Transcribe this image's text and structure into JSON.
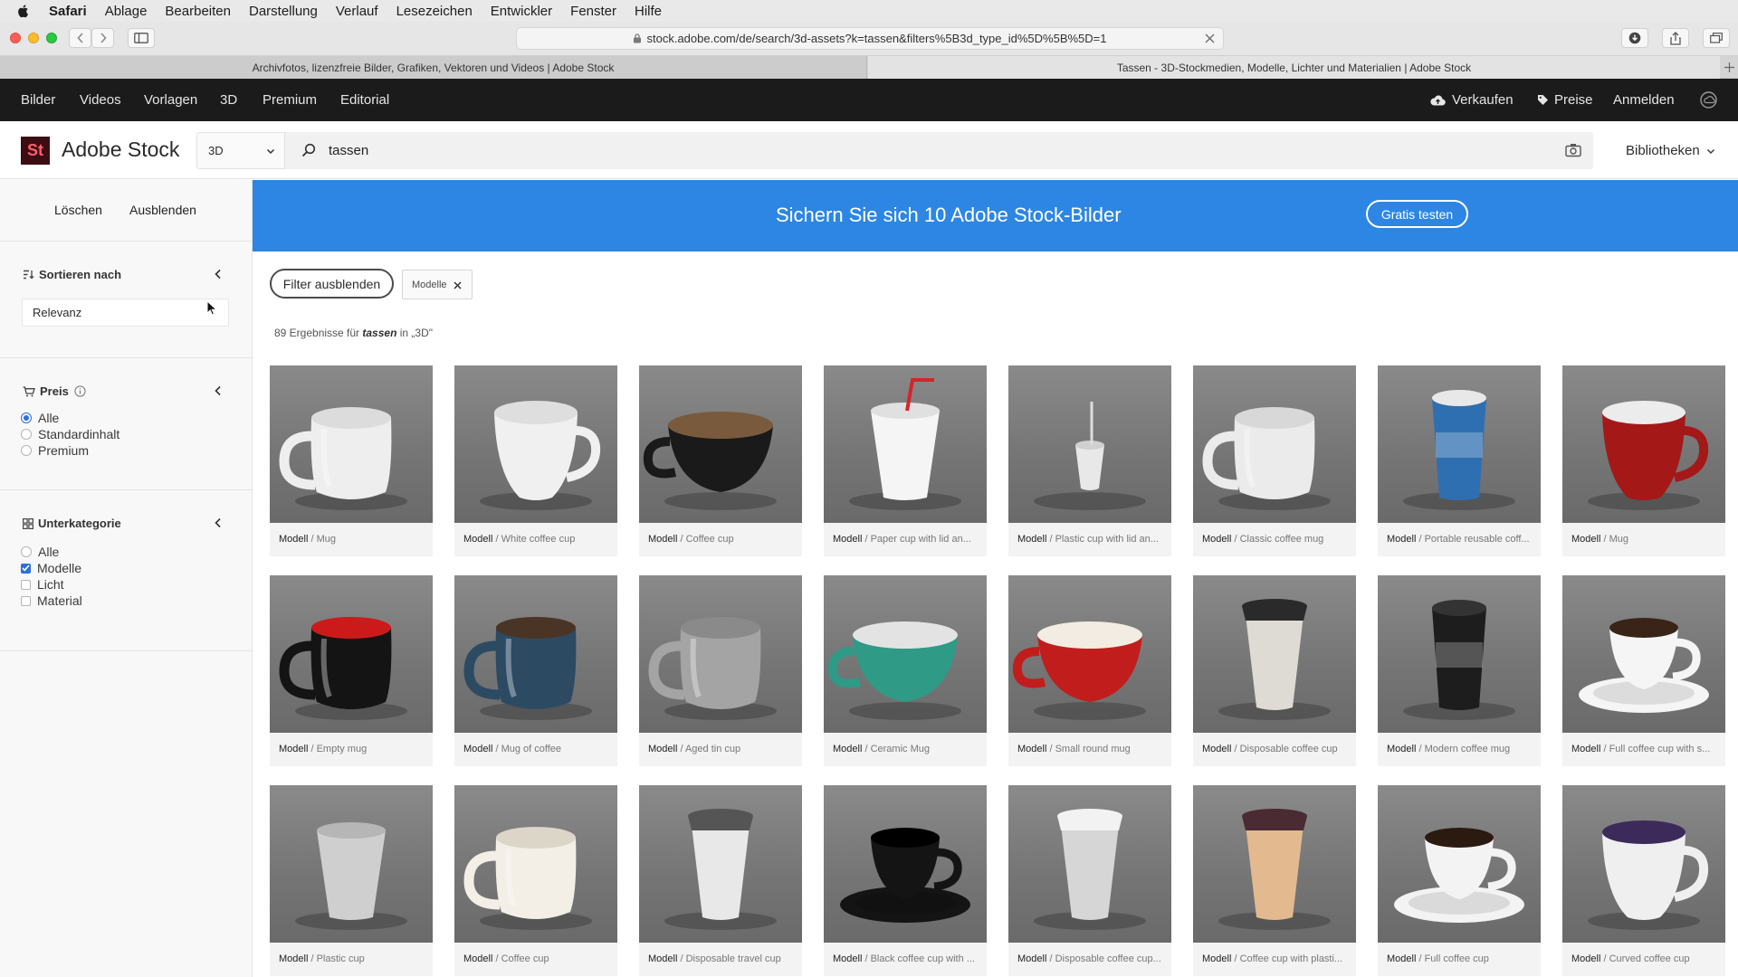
{
  "menubar": {
    "app": "Safari",
    "items": [
      "Ablage",
      "Bearbeiten",
      "Darstellung",
      "Verlauf",
      "Lesezeichen",
      "Entwickler",
      "Fenster",
      "Hilfe"
    ]
  },
  "browser": {
    "url": "stock.adobe.com/de/search/3d-assets?k=tassen&filters%5B3d_type_id%5D%5B%5D=1",
    "tabs": [
      {
        "title": "Archivfotos, lizenzfreie Bilder, Grafiken, Vektoren und Videos | Adobe Stock"
      },
      {
        "title": "Tassen - 3D-Stockmedien, Modelle, Lichter und Materialien | Adobe Stock"
      }
    ]
  },
  "topnav": {
    "items": [
      "Bilder",
      "Videos",
      "Vorlagen",
      "3D",
      "Premium",
      "Editorial"
    ],
    "sell": "Verkaufen",
    "pricing": "Preise",
    "signin": "Anmelden"
  },
  "header": {
    "logo_mark": "St",
    "logo_text": "Adobe Stock",
    "category": "3D",
    "search_value": "tassen",
    "libraries": "Bibliotheken"
  },
  "sidebar": {
    "clear": "Löschen",
    "hide": "Ausblenden",
    "sort": {
      "title": "Sortieren nach",
      "value": "Relevanz"
    },
    "price": {
      "title": "Preis",
      "options": [
        "Alle",
        "Standardinhalt",
        "Premium"
      ],
      "selected": 0
    },
    "subcategory": {
      "title": "Unterkategorie",
      "options": [
        "Alle",
        "Modelle",
        "Licht",
        "Material"
      ],
      "checked": 1
    }
  },
  "banner": {
    "text": "Sichern Sie sich 10 Adobe Stock-Bilder",
    "button": "Gratis testen"
  },
  "filters": {
    "toggle": "Filter ausblenden",
    "tag": "Modelle"
  },
  "results": {
    "prefix": "89 Ergebnisse für ",
    "query": "tassen",
    "suffix": " in „3D\""
  },
  "colors": {
    "banner": "#2d86e3",
    "nav": "#1b1b1b",
    "accent": "#2d6fde",
    "logo": "#3d0d13"
  },
  "assets": [
    {
      "kind": "Modell",
      "name": "Mug",
      "shape": "mug",
      "color": "#eeeeee",
      "inner": "#dcdcdc"
    },
    {
      "kind": "Modell",
      "name": "White coffee cup",
      "shape": "cup",
      "color": "#f0f0f0",
      "inner": "#dedede"
    },
    {
      "kind": "Modell",
      "name": "Coffee cup",
      "shape": "bowl",
      "color": "#1a1a1a",
      "inner": "#7a5a3c"
    },
    {
      "kind": "Modell",
      "name": "Paper cup with lid an...",
      "shape": "paper",
      "color": "#f5f5f5",
      "inner": "#e0e0e0",
      "straw": "#d6242a"
    },
    {
      "kind": "Modell",
      "name": "Plastic cup with lid an...",
      "shape": "small",
      "color": "#e8e8e8",
      "inner": "#d0d0d0",
      "straw": "#dddddd"
    },
    {
      "kind": "Modell",
      "name": "Classic coffee mug",
      "shape": "mug",
      "color": "#ebebeb",
      "inner": "#d8d8d8"
    },
    {
      "kind": "Modell",
      "name": "Portable reusable coff...",
      "shape": "tall",
      "color": "#2e6fb1",
      "inner": "#e8e8e8"
    },
    {
      "kind": "Modell",
      "name": "Mug",
      "shape": "cup",
      "color": "#a51818",
      "inner": "#ececec"
    },
    {
      "kind": "Modell",
      "name": "Empty mug",
      "shape": "mug",
      "color": "#141414",
      "inner": "#cc1a1a"
    },
    {
      "kind": "Modell",
      "name": "Mug of coffee",
      "shape": "mug",
      "color": "#2d4a63",
      "inner": "#4a3425"
    },
    {
      "kind": "Modell",
      "name": "Aged tin cup",
      "shape": "mug",
      "color": "#a4a4a4",
      "inner": "#8a8a8a"
    },
    {
      "kind": "Modell",
      "name": "Ceramic Mug",
      "shape": "bowl",
      "color": "#2f9a86",
      "inner": "#e3e3e3"
    },
    {
      "kind": "Modell",
      "name": "Small round mug",
      "shape": "bowl",
      "color": "#c21d1d",
      "inner": "#f2ece2"
    },
    {
      "kind": "Modell",
      "name": "Disposable coffee cup",
      "shape": "takeaway",
      "color": "#dedad4",
      "inner": "#2a2a2a"
    },
    {
      "kind": "Modell",
      "name": "Modern coffee mug",
      "shape": "tall",
      "color": "#1d1d1d",
      "inner": "#333333"
    },
    {
      "kind": "Modell",
      "name": "Full coffee cup with s...",
      "shape": "saucer",
      "color": "#f5f5f5",
      "inner": "#3a2418"
    },
    {
      "kind": "Modell",
      "name": "Plastic cup",
      "shape": "paper",
      "color": "#cfcfcf",
      "inner": "#b6b6b6"
    },
    {
      "kind": "Modell",
      "name": "Coffee cup",
      "shape": "mug",
      "color": "#f3efe6",
      "inner": "#dcd6c8"
    },
    {
      "kind": "Modell",
      "name": "Disposable travel cup",
      "shape": "takeaway",
      "color": "#e8e8e8",
      "inner": "#555555"
    },
    {
      "kind": "Modell",
      "name": "Black coffee cup with ...",
      "shape": "saucer",
      "color": "#141414",
      "inner": "#000000"
    },
    {
      "kind": "Modell",
      "name": "Disposable coffee cup...",
      "shape": "takeaway",
      "color": "#d6d6d6",
      "inner": "#f2f2f2"
    },
    {
      "kind": "Modell",
      "name": "Coffee cup with plasti...",
      "shape": "takeaway",
      "color": "#e3b98f",
      "inner": "#4a2a33"
    },
    {
      "kind": "Modell",
      "name": "Full coffee cup",
      "shape": "saucer",
      "color": "#f3f3f3",
      "inner": "#2b1a10"
    },
    {
      "kind": "Modell",
      "name": "Curved coffee cup",
      "shape": "cup",
      "color": "#efefef",
      "inner": "#3b2a5a"
    }
  ]
}
